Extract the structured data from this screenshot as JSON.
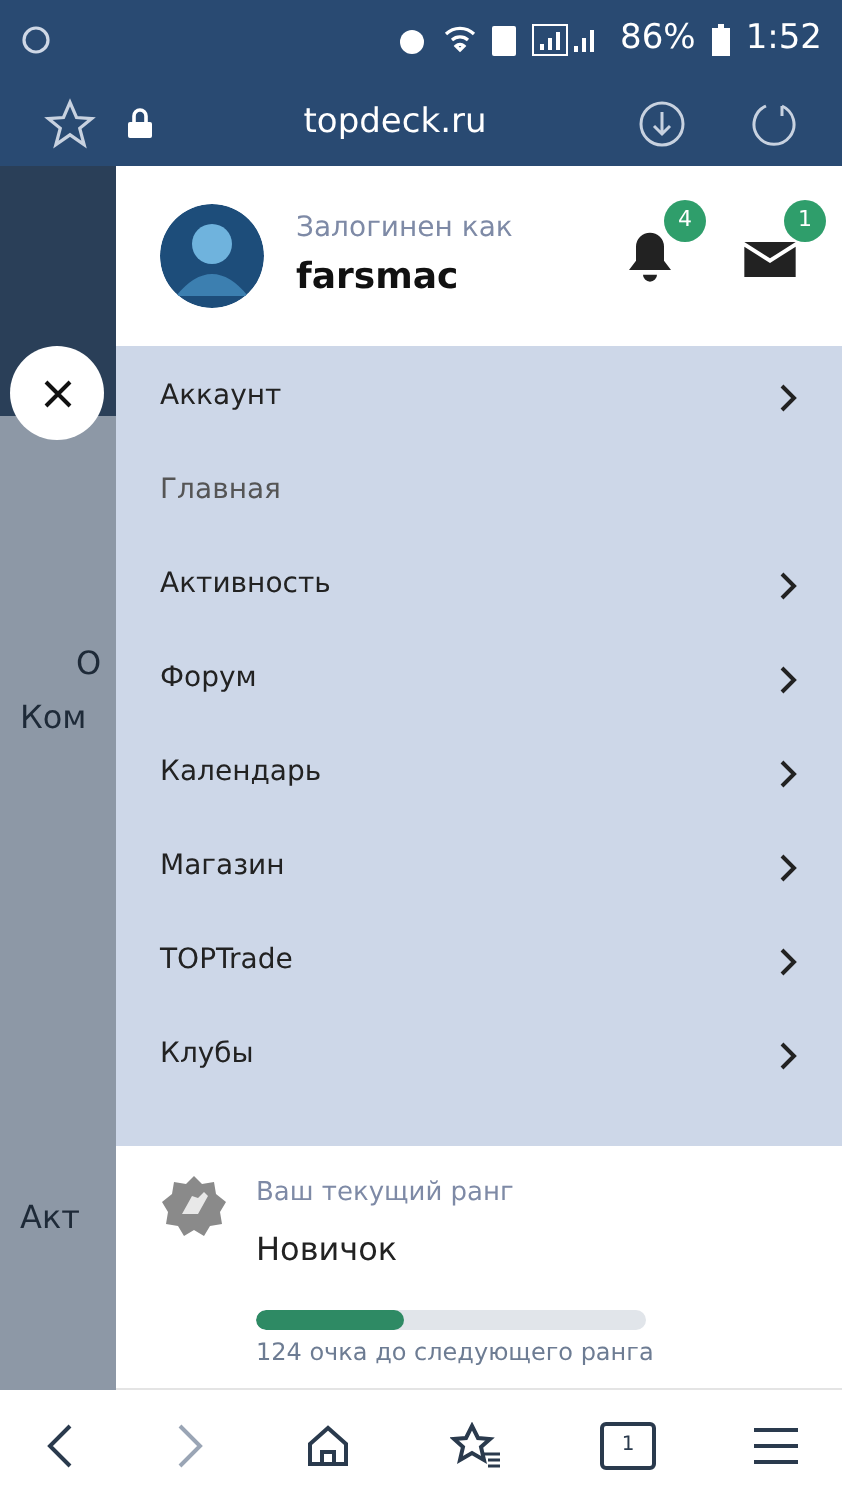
{
  "status_bar": {
    "battery": "86%",
    "time": "1:52"
  },
  "address_bar": {
    "url": "topdeck.ru"
  },
  "backdrop": {
    "texts": [
      {
        "text": "О"
      },
      {
        "text": "Ком"
      },
      {
        "text": "Акт"
      }
    ]
  },
  "drawer": {
    "user": {
      "caption": "Залогинен как",
      "name": "farsmac"
    },
    "notifications": {
      "count": "4"
    },
    "messages": {
      "count": "1"
    },
    "menu": [
      {
        "label": "Аккаунт",
        "has_submenu": true
      },
      {
        "label": "Главная",
        "has_submenu": false
      },
      {
        "label": "Активность",
        "has_submenu": true
      },
      {
        "label": "Форум",
        "has_submenu": true
      },
      {
        "label": "Календарь",
        "has_submenu": true
      },
      {
        "label": "Магазин",
        "has_submenu": true
      },
      {
        "label": "TOPTrade",
        "has_submenu": true
      },
      {
        "label": "Клубы",
        "has_submenu": true
      }
    ],
    "rank": {
      "caption": "Ваш текущий ранг",
      "name": "Новичок",
      "level": 0.38,
      "note": "124 очка до следующего ранга"
    }
  },
  "bottom_nav": {
    "tab_count": "1"
  }
}
